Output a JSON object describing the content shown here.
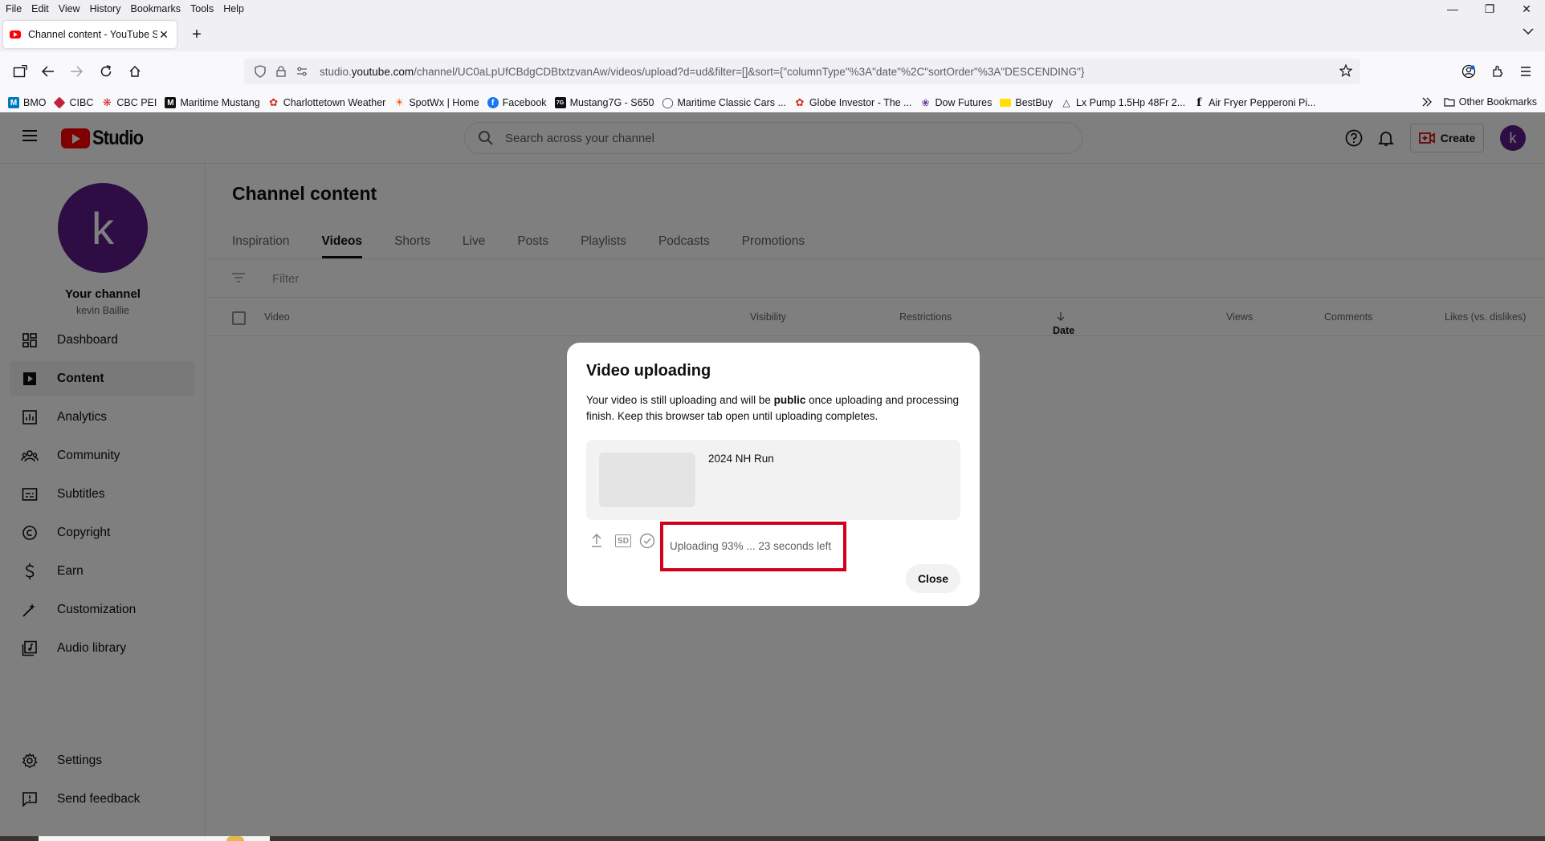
{
  "menubar": {
    "items": [
      "File",
      "Edit",
      "View",
      "History",
      "Bookmarks",
      "Tools",
      "Help"
    ]
  },
  "browser": {
    "tab_title": "Channel content - YouTube Stu",
    "url_prefix": "studio.",
    "url_domain": "youtube.com",
    "url_rest": "/channel/UC0aLpUfCBdgCDBtxtzvanAw/videos/upload?d=ud&filter=[]&sort={\"columnType\"%3A\"date\"%2C\"sortOrder\"%3A\"DESCENDING\"}"
  },
  "bookmarks": {
    "items": [
      {
        "label": "BMO",
        "icon": "bmo-icon",
        "color": "#0079c1"
      },
      {
        "label": "CIBC",
        "icon": "cibc-icon",
        "color": "#c41f3e"
      },
      {
        "label": "CBC PEI",
        "icon": "cbc-icon",
        "color": "#d32f2f"
      },
      {
        "label": "Maritime Mustang",
        "icon": "maritime-mustang-icon",
        "color": "#111111"
      },
      {
        "label": "Charlottetown Weather",
        "icon": "maple-leaf-icon",
        "color": "#d52b1e"
      },
      {
        "label": "SpotWx | Home",
        "icon": "spotwx-icon",
        "color": "#e65c00"
      },
      {
        "label": "Facebook",
        "icon": "facebook-icon",
        "color": "#1877f2"
      },
      {
        "label": "Mustang7G - S650",
        "icon": "mustang7g-icon",
        "color": "#111111"
      },
      {
        "label": "Maritime Classic Cars ...",
        "icon": "globe-icon",
        "color": "#444444"
      },
      {
        "label": "Globe Investor - The ...",
        "icon": "maple-leaf-icon",
        "color": "#d52b1e"
      },
      {
        "label": "Dow Futures",
        "icon": "nbc-peacock-icon",
        "color": "#6a3fa0"
      },
      {
        "label": "BestBuy",
        "icon": "bestbuy-icon",
        "color": "#ffe000"
      },
      {
        "label": "Lx Pump 1.5Hp 48Fr 2...",
        "icon": "chart-icon",
        "color": "#333333"
      },
      {
        "label": "Air Fryer Pepperoni Pi...",
        "icon": "f-icon",
        "color": "#111111"
      }
    ],
    "other": "Other Bookmarks"
  },
  "studio": {
    "logo_text": "Studio",
    "search_placeholder": "Search across your channel",
    "create_label": "Create",
    "avatar_letter": "k",
    "channel": {
      "avatar_letter": "k",
      "title": "Your channel",
      "name": "kevin Baillie"
    },
    "nav": [
      {
        "label": "Dashboard",
        "icon": "dashboard-icon"
      },
      {
        "label": "Content",
        "icon": "content-icon",
        "active": true
      },
      {
        "label": "Analytics",
        "icon": "analytics-icon"
      },
      {
        "label": "Community",
        "icon": "community-icon"
      },
      {
        "label": "Subtitles",
        "icon": "subtitles-icon"
      },
      {
        "label": "Copyright",
        "icon": "copyright-icon"
      },
      {
        "label": "Earn",
        "icon": "earn-icon"
      },
      {
        "label": "Customization",
        "icon": "customization-icon"
      },
      {
        "label": "Audio library",
        "icon": "audio-library-icon"
      }
    ],
    "nav_bottom": [
      {
        "label": "Settings",
        "icon": "settings-icon"
      },
      {
        "label": "Send feedback",
        "icon": "feedback-icon"
      }
    ],
    "page_title": "Channel content",
    "tabs": [
      "Inspiration",
      "Videos",
      "Shorts",
      "Live",
      "Posts",
      "Playlists",
      "Podcasts",
      "Promotions"
    ],
    "active_tab": "Videos",
    "filter_placeholder": "Filter",
    "columns": {
      "video": "Video",
      "visibility": "Visibility",
      "restrictions": "Restrictions",
      "date": "Date",
      "views": "Views",
      "comments": "Comments",
      "likes": "Likes (vs. dislikes)"
    }
  },
  "modal": {
    "title": "Video uploading",
    "body_pre": "Your video is still uploading and will be ",
    "body_bold": "public",
    "body_post": " once uploading and processing finish. Keep this browser tab open until uploading completes.",
    "video_title": "2024 NH Run",
    "hd_badge": "SD",
    "upload_status": "Uploading 93% ... 23 seconds left",
    "upload_progress_percent": 93,
    "close_label": "Close",
    "highlight_color": "#d3001c"
  }
}
